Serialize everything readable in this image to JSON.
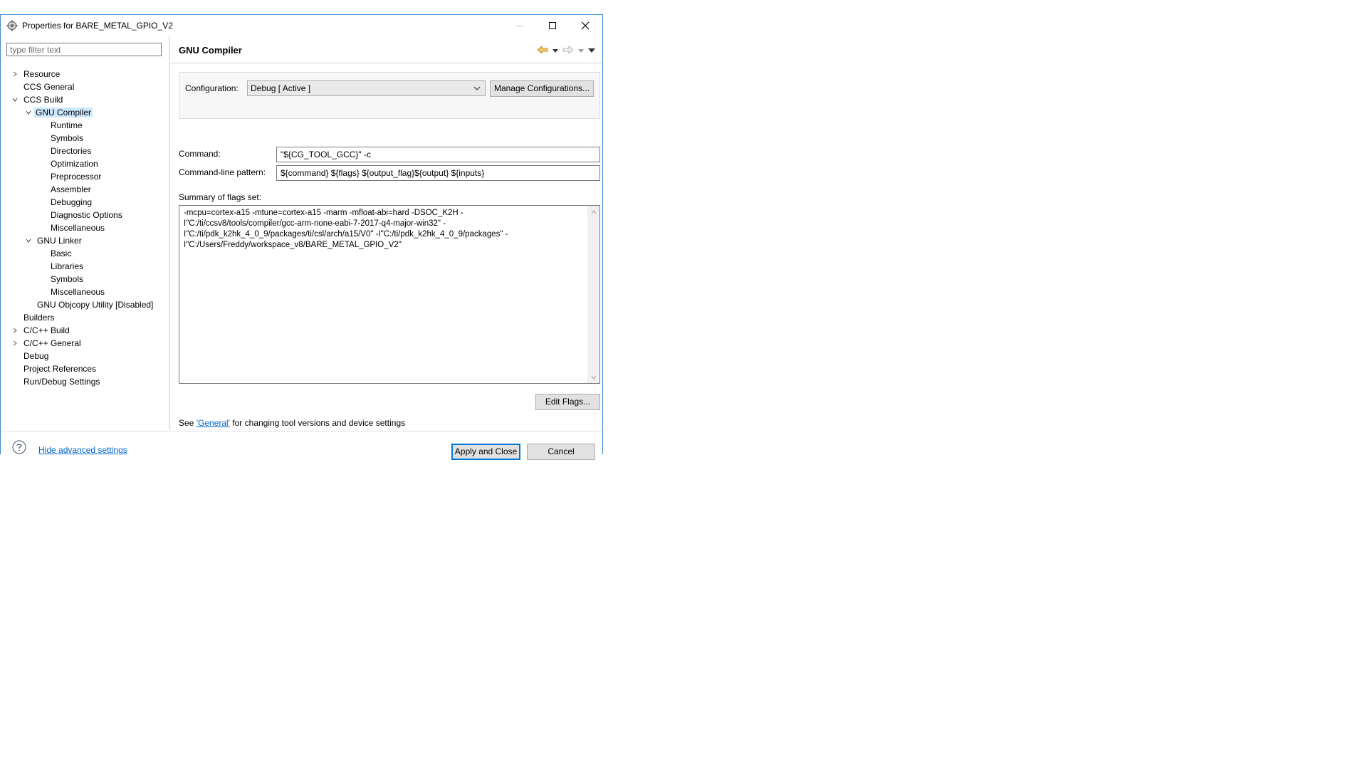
{
  "window": {
    "title": "Properties for BARE_METAL_GPIO_V2",
    "minimize_icon": "minimize-icon",
    "maximize_icon": "maximize-icon",
    "close_icon": "close-icon"
  },
  "filter": {
    "placeholder": "type filter text"
  },
  "tree": {
    "resource": "Resource",
    "ccs_general": "CCS General",
    "ccs_build": "CCS Build",
    "gnu_compiler": "GNU Compiler",
    "runtime": "Runtime",
    "symbols": "Symbols",
    "directories": "Directories",
    "optimization": "Optimization",
    "preprocessor": "Preprocessor",
    "assembler": "Assembler",
    "debugging": "Debugging",
    "diagnostic_options": "Diagnostic Options",
    "miscellaneous": "Miscellaneous",
    "gnu_linker": "GNU Linker",
    "basic": "Basic",
    "libraries": "Libraries",
    "linker_symbols": "Symbols",
    "linker_miscellaneous": "Miscellaneous",
    "gnu_objcopy": "GNU Objcopy Utility  [Disabled]",
    "builders": "Builders",
    "cpp_build": "C/C++ Build",
    "cpp_general": "C/C++ General",
    "debug": "Debug",
    "project_references": "Project References",
    "run_debug_settings": "Run/Debug Settings"
  },
  "page": {
    "title": "GNU Compiler",
    "configuration_label": "Configuration:",
    "configuration_value": "Debug  [ Active ]",
    "manage_configurations": "Manage Configurations...",
    "command_label": "Command:",
    "command_value": "\"${CG_TOOL_GCC}\" -c",
    "pattern_label": "Command-line pattern:",
    "pattern_value": "${command} ${flags} ${output_flag}${output} ${inputs}",
    "summary_label": "Summary of flags set:",
    "summary_text": "-mcpu=cortex-a15 -mtune=cortex-a15 -marm -mfloat-abi=hard -DSOC_K2H -\nI\"C:/ti/ccsv8/tools/compiler/gcc-arm-none-eabi-7-2017-q4-major-win32\" -\nI\"C:/ti/pdk_k2hk_4_0_9/packages/ti/csl/arch/a15/V0\" -I\"C:/ti/pdk_k2hk_4_0_9/packages\" -\nI\"C:/Users/Freddy/workspace_v8/BARE_METAL_GPIO_V2\"",
    "edit_flags": "Edit Flags...",
    "see_prefix": "See ",
    "see_link": "'General'",
    "see_suffix": " for changing tool versions and device settings"
  },
  "bottom": {
    "help_icon": "help-icon",
    "hide_advanced": "Hide advanced settings",
    "apply_close": "Apply and Close",
    "cancel": "Cancel"
  },
  "colors": {
    "accent": "#0078d7",
    "selection": "#cce8ff",
    "link": "#0066cc",
    "nav_arrow": "#e8a33c"
  }
}
